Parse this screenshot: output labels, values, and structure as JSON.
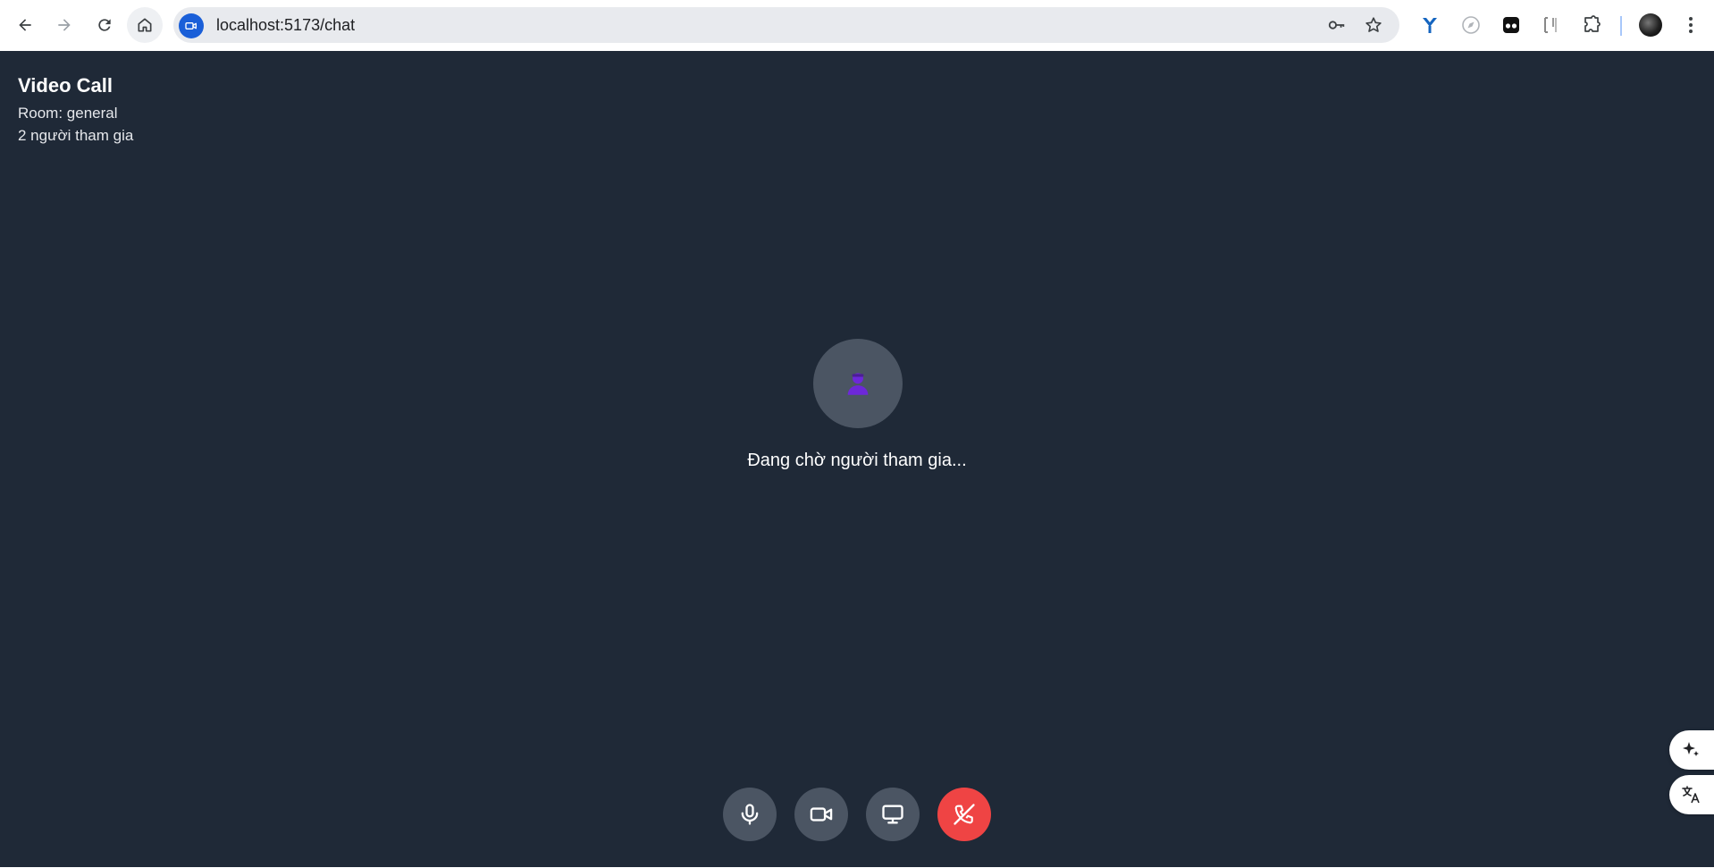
{
  "browser": {
    "url": "localhost:5173/chat",
    "icons": {
      "back": "arrow-left-icon",
      "forward": "arrow-right-icon",
      "reload": "reload-icon",
      "home": "home-icon",
      "site": "video-camera-icon",
      "password": "key-icon",
      "bookmark": "star-icon",
      "extensions": [
        "y-extension-icon",
        "compass-extension-icon",
        "glasses-extension-icon",
        "bracket-extension-icon",
        "puzzle-icon"
      ],
      "menu": "kebab-menu-icon"
    },
    "colors": {
      "site_chip": "#1a5fd8",
      "omnibox_bg": "#e8eaee"
    }
  },
  "call": {
    "title": "Video Call",
    "room_label": "Room: general",
    "participants_label": "2 người tham gia",
    "waiting_text": "Đang chờ người tham gia...",
    "placeholder_icon": "user-silhouette-icon"
  },
  "controls": [
    {
      "name": "microphone",
      "icon": "microphone-icon"
    },
    {
      "name": "camera",
      "icon": "video-camera-icon"
    },
    {
      "name": "screen-share",
      "icon": "monitor-icon"
    },
    {
      "name": "end-call",
      "icon": "phone-off-icon",
      "color": "#ef4444"
    }
  ],
  "side_buttons": [
    {
      "icon": "sparkle-icon"
    },
    {
      "icon": "translate-icon"
    }
  ],
  "colors": {
    "page_bg": "#1f2937",
    "button_bg": "#4b5563",
    "end_call": "#ef4444",
    "placeholder_icon": "#6d28d9"
  }
}
